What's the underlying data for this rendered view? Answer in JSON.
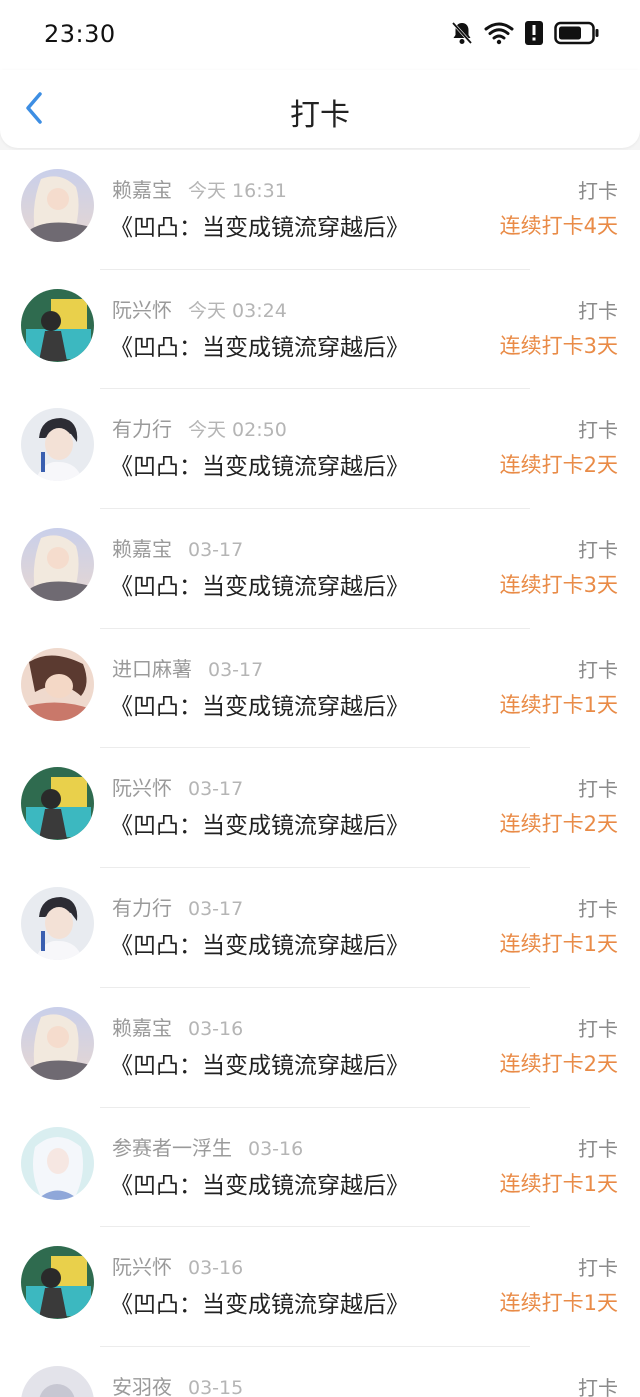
{
  "status_bar": {
    "time": "23:30",
    "icons": [
      "bell-muted-icon",
      "wifi-icon",
      "alert-icon",
      "battery-icon"
    ]
  },
  "header": {
    "title": "打卡",
    "back_icon": "chevron-left-icon"
  },
  "colors": {
    "accent_blue": "#3d8ee3",
    "streak_orange": "#e98b47"
  },
  "items": [
    {
      "user": "赖嘉宝",
      "time": "今天 16:31",
      "work": "《凹凸：当变成镜流穿越后》",
      "tag": "打卡",
      "streak": "连续打卡4天",
      "avatar": "avatar-a"
    },
    {
      "user": "阮兴怀",
      "time": "今天 03:24",
      "work": "《凹凸：当变成镜流穿越后》",
      "tag": "打卡",
      "streak": "连续打卡3天",
      "avatar": "avatar-b"
    },
    {
      "user": "有力行",
      "time": "今天 02:50",
      "work": "《凹凸：当变成镜流穿越后》",
      "tag": "打卡",
      "streak": "连续打卡2天",
      "avatar": "avatar-c"
    },
    {
      "user": "赖嘉宝",
      "time": "03-17",
      "work": "《凹凸：当变成镜流穿越后》",
      "tag": "打卡",
      "streak": "连续打卡3天",
      "avatar": "avatar-a"
    },
    {
      "user": "进口麻薯",
      "time": "03-17",
      "work": "《凹凸：当变成镜流穿越后》",
      "tag": "打卡",
      "streak": "连续打卡1天",
      "avatar": "avatar-d"
    },
    {
      "user": "阮兴怀",
      "time": "03-17",
      "work": "《凹凸：当变成镜流穿越后》",
      "tag": "打卡",
      "streak": "连续打卡2天",
      "avatar": "avatar-b"
    },
    {
      "user": "有力行",
      "time": "03-17",
      "work": "《凹凸：当变成镜流穿越后》",
      "tag": "打卡",
      "streak": "连续打卡1天",
      "avatar": "avatar-c"
    },
    {
      "user": "赖嘉宝",
      "time": "03-16",
      "work": "《凹凸：当变成镜流穿越后》",
      "tag": "打卡",
      "streak": "连续打卡2天",
      "avatar": "avatar-a"
    },
    {
      "user": "参赛者一浮生",
      "time": "03-16",
      "work": "《凹凸：当变成镜流穿越后》",
      "tag": "打卡",
      "streak": "连续打卡1天",
      "avatar": "avatar-e"
    },
    {
      "user": "阮兴怀",
      "time": "03-16",
      "work": "《凹凸：当变成镜流穿越后》",
      "tag": "打卡",
      "streak": "连续打卡1天",
      "avatar": "avatar-b"
    },
    {
      "user": "安羽夜",
      "time": "03-15",
      "work": "",
      "tag": "打卡",
      "streak": "",
      "avatar": "avatar-f"
    }
  ]
}
